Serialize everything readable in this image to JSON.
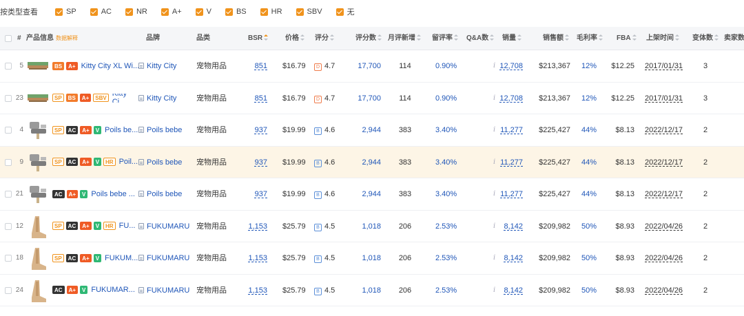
{
  "filter": {
    "label": "按类型查看",
    "options": [
      "SP",
      "AC",
      "NR",
      "A+",
      "V",
      "BS",
      "HR",
      "SBV",
      "无"
    ]
  },
  "headers": {
    "index": "#",
    "product": "产品信息",
    "product_hint": "数据解释",
    "brand": "品牌",
    "category": "品类",
    "bsr": "BSR",
    "price": "价格",
    "rating": "评分",
    "reviews": "评分数",
    "monthly_new_reviews": "月评新增",
    "review_rate": "留评率",
    "qa": "Q&A数",
    "sales": "销量",
    "revenue": "销售额",
    "margin": "毛利率",
    "fba": "FBA",
    "listing_date": "上架时间",
    "variants": "变体数",
    "sellers": "卖家数"
  },
  "rows": [
    {
      "idx": "5",
      "badges": [
        "BS",
        "A+"
      ],
      "title": "Kitty City XL Wi...",
      "brand": "Kitty City",
      "category": "宠物用品",
      "bsr": "851",
      "price": "$16.79",
      "rating_grade": "D",
      "rating": "4.7",
      "reviews": "17,700",
      "monthly_new": "114",
      "review_rate": "0.90%",
      "qa": "i",
      "sales": "12,708",
      "revenue": "$213,367",
      "margin": "12%",
      "fba": "$12.25",
      "date": "2017/01/31",
      "variants": "3",
      "img": "flat",
      "highlight": false
    },
    {
      "idx": "23",
      "badges": [
        "SP",
        "BS",
        "A+",
        "SBV"
      ],
      "title": "Kitty Ci...",
      "brand": "Kitty City",
      "category": "宠物用品",
      "bsr": "851",
      "price": "$16.79",
      "rating_grade": "D",
      "rating": "4.7",
      "reviews": "17,700",
      "monthly_new": "114",
      "review_rate": "0.90%",
      "qa": "i",
      "sales": "12,708",
      "revenue": "$213,367",
      "margin": "12%",
      "fba": "$12.25",
      "date": "2017/01/31",
      "variants": "3",
      "img": "flat",
      "highlight": false
    },
    {
      "idx": "4",
      "badges": [
        "SP",
        "AC",
        "A+",
        "V"
      ],
      "title": "Poils be...",
      "brand": "Poils bebe",
      "category": "宠物用品",
      "bsr": "937",
      "price": "$19.99",
      "rating_grade": "B",
      "rating": "4.6",
      "reviews": "2,944",
      "monthly_new": "383",
      "review_rate": "3.40%",
      "qa": "i",
      "sales": "11,277",
      "revenue": "$225,427",
      "margin": "44%",
      "fba": "$8.13",
      "date": "2022/12/17",
      "variants": "2",
      "img": "brush",
      "highlight": false
    },
    {
      "idx": "9",
      "badges": [
        "SP",
        "AC",
        "A+",
        "V",
        "HR"
      ],
      "title": "Poil...",
      "brand": "Poils bebe",
      "category": "宠物用品",
      "bsr": "937",
      "price": "$19.99",
      "rating_grade": "B",
      "rating": "4.6",
      "reviews": "2,944",
      "monthly_new": "383",
      "review_rate": "3.40%",
      "qa": "i",
      "sales": "11,277",
      "revenue": "$225,427",
      "margin": "44%",
      "fba": "$8.13",
      "date": "2022/12/17",
      "variants": "2",
      "img": "brush",
      "highlight": true
    },
    {
      "idx": "21",
      "badges": [
        "AC",
        "A+",
        "V"
      ],
      "title": "Poils bebe ...",
      "brand": "Poils bebe",
      "category": "宠物用品",
      "bsr": "937",
      "price": "$19.99",
      "rating_grade": "B",
      "rating": "4.6",
      "reviews": "2,944",
      "monthly_new": "383",
      "review_rate": "3.40%",
      "qa": "i",
      "sales": "11,277",
      "revenue": "$225,427",
      "margin": "44%",
      "fba": "$8.13",
      "date": "2022/12/17",
      "variants": "2",
      "img": "brush",
      "highlight": false
    },
    {
      "idx": "12",
      "badges": [
        "SP",
        "AC",
        "A+",
        "V",
        "HR"
      ],
      "title": "FU...",
      "brand": "FUKUMARU",
      "category": "宠物用品",
      "bsr": "1,153",
      "price": "$25.79",
      "rating_grade": "B",
      "rating": "4.5",
      "reviews": "1,018",
      "monthly_new": "206",
      "review_rate": "2.53%",
      "qa": "i",
      "sales": "8,142",
      "revenue": "$209,982",
      "margin": "50%",
      "fba": "$8.93",
      "date": "2022/04/26",
      "variants": "2",
      "img": "tall",
      "highlight": false
    },
    {
      "idx": "18",
      "badges": [
        "SP",
        "AC",
        "A+",
        "V"
      ],
      "title": "FUKUM...",
      "brand": "FUKUMARU",
      "category": "宠物用品",
      "bsr": "1,153",
      "price": "$25.79",
      "rating_grade": "B",
      "rating": "4.5",
      "reviews": "1,018",
      "monthly_new": "206",
      "review_rate": "2.53%",
      "qa": "i",
      "sales": "8,142",
      "revenue": "$209,982",
      "margin": "50%",
      "fba": "$8.93",
      "date": "2022/04/26",
      "variants": "2",
      "img": "tall",
      "highlight": false
    },
    {
      "idx": "24",
      "badges": [
        "AC",
        "A+",
        "V"
      ],
      "title": "FUKUMAR...",
      "brand": "FUKUMARU",
      "category": "宠物用品",
      "bsr": "1,153",
      "price": "$25.79",
      "rating_grade": "B",
      "rating": "4.5",
      "reviews": "1,018",
      "monthly_new": "206",
      "review_rate": "2.53%",
      "qa": "i",
      "sales": "8,142",
      "revenue": "$209,982",
      "margin": "50%",
      "fba": "$8.93",
      "date": "2022/04/26",
      "variants": "2",
      "img": "tall",
      "highlight": false
    }
  ],
  "colors": {
    "accent": "#f0931c",
    "link": "#1f56b8",
    "highlight_row": "#fdf5e6",
    "header_bg": "#f5f6f8"
  }
}
